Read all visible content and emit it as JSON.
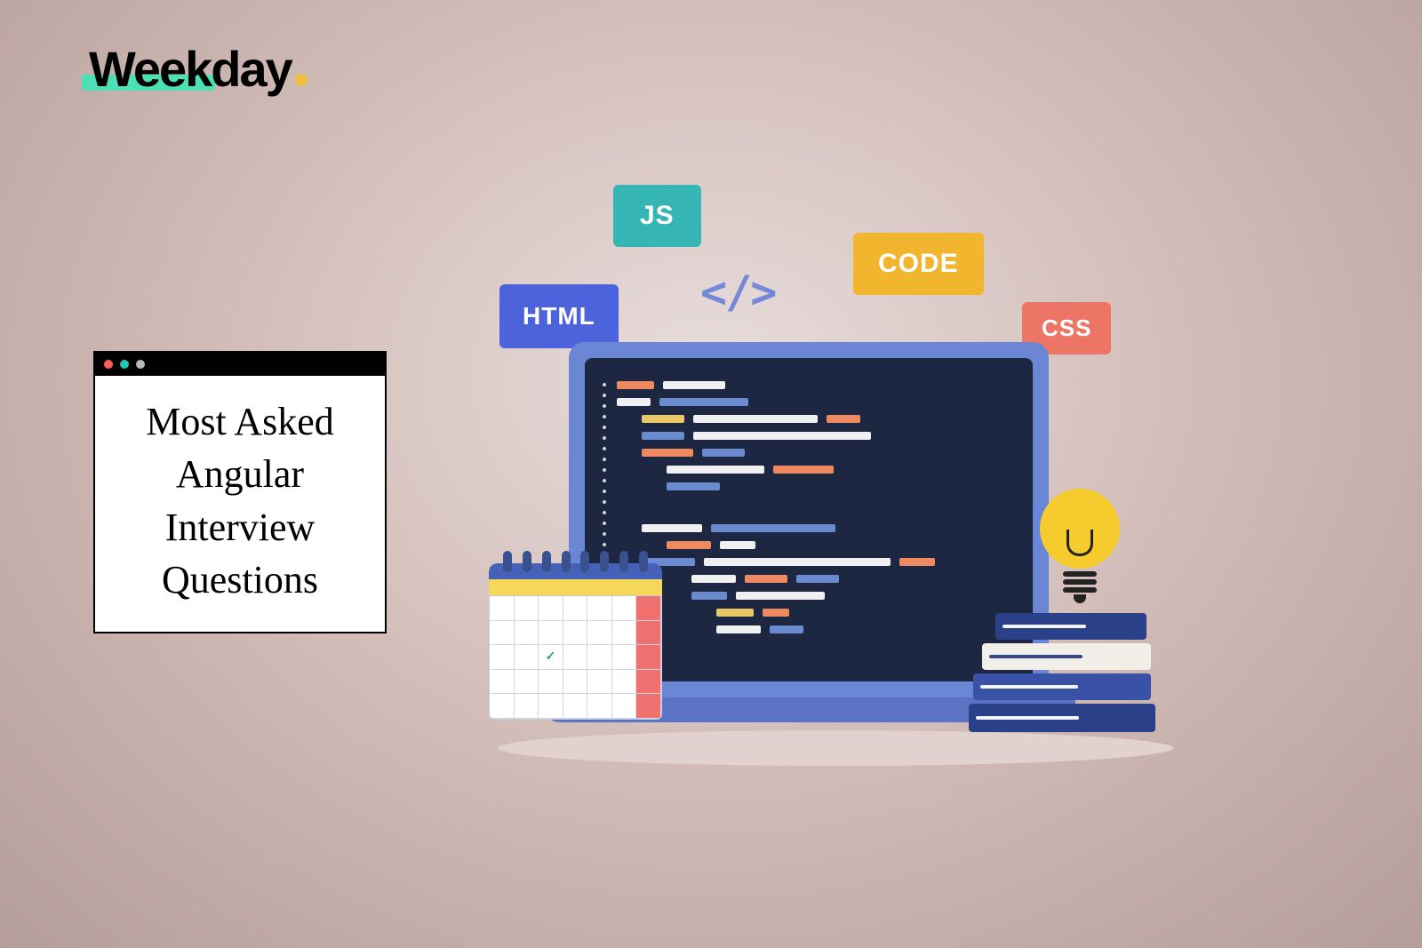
{
  "logo": {
    "text": "Weekday"
  },
  "window": {
    "title_lines": "Most Asked Angular Interview Questions"
  },
  "tags": {
    "js": "JS",
    "html": "HTML",
    "code": "CODE",
    "css": "CSS"
  },
  "code_bracket_glyph": "</>",
  "colors": {
    "tag_js": "#36b5b5",
    "tag_html": "#4d63db",
    "tag_code": "#f2b52e",
    "tag_css": "#ec7566",
    "accent_mint": "#4de0b5",
    "accent_yellow": "#f0c040"
  }
}
